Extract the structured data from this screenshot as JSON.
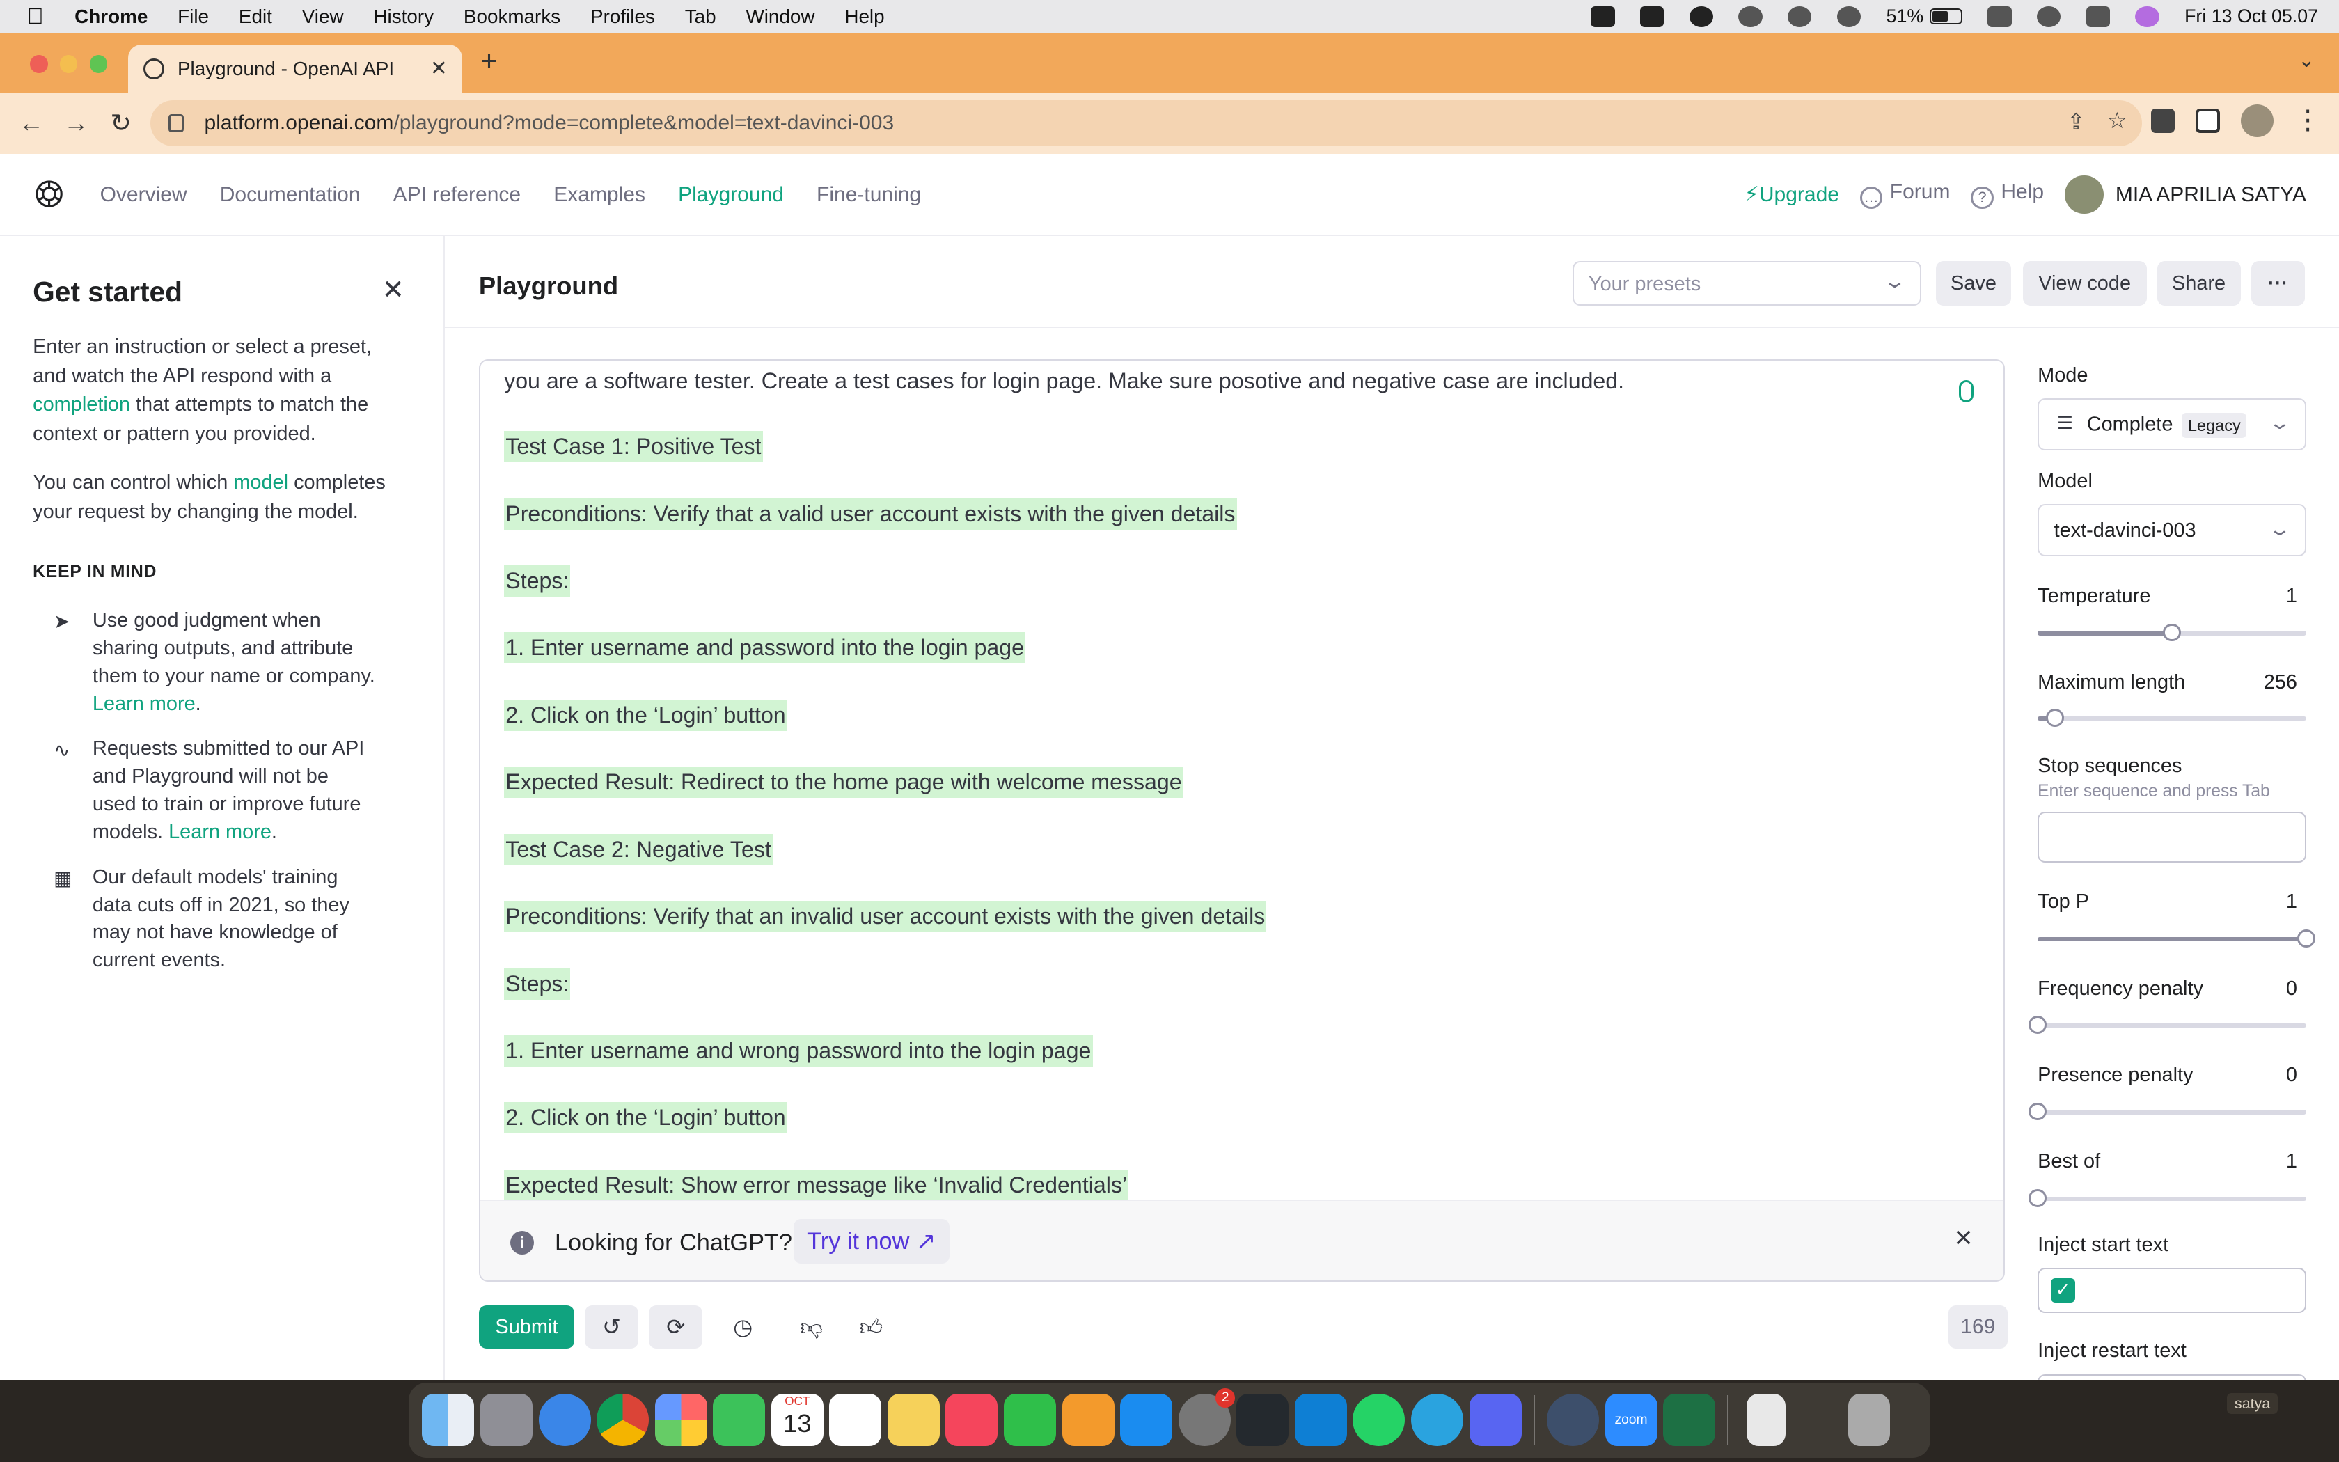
{
  "menubar": {
    "app": "Chrome",
    "items": [
      "File",
      "Edit",
      "View",
      "History",
      "Bookmarks",
      "Profiles",
      "Tab",
      "Window",
      "Help"
    ],
    "battery": "51%",
    "datetime": "Fri 13 Oct  05.07"
  },
  "browser": {
    "tab_title": "Playground - OpenAI API",
    "url_host": "platform.openai.com",
    "url_path": "/playground?mode=complete&model=text-davinci-003"
  },
  "nav": {
    "links": [
      "Overview",
      "Documentation",
      "API reference",
      "Examples",
      "Playground",
      "Fine-tuning"
    ],
    "upgrade": "Upgrade",
    "forum": "Forum",
    "help": "Help",
    "user": "MIA APRILIA SATYA"
  },
  "sidebar": {
    "title": "Get started",
    "intro_a": "Enter an instruction or select a preset, and watch the API respond with a ",
    "intro_link": "completion",
    "intro_b": " that attempts to match the context or pattern you provided.",
    "model_a": "You can control which ",
    "model_link": "model",
    "model_b": " completes your request by changing the model.",
    "keep_in_mind": "KEEP IN MIND",
    "tips": [
      {
        "text": "Use good judgment when sharing outputs, and attribute them to your name or company. ",
        "link": "Learn more",
        "tail": "."
      },
      {
        "text": "Requests submitted to our API and Playground will not be used to train or improve future models. ",
        "link": "Learn more",
        "tail": "."
      },
      {
        "text": "Our default models' training data cuts off in 2021, so they may not have knowledge of current events.",
        "link": "",
        "tail": ""
      }
    ]
  },
  "header": {
    "title": "Playground",
    "presets_placeholder": "Your presets",
    "save": "Save",
    "view_code": "View code",
    "share": "Share",
    "more": "···"
  },
  "editor": {
    "prompt": "you are a software tester. Create a test cases for login page. Make sure posotive and negative case are included.",
    "completion_lines": [
      "Test Case 1: Positive Test",
      "Preconditions: Verify that a valid user account exists with the given details",
      "Steps:",
      "1. Enter username and password into the login page",
      "2. Click on the ‘Login’ button",
      "Expected Result: Redirect to the home page with welcome message",
      "Test Case 2: Negative Test",
      "Preconditions: Verify that an invalid user account exists with the given details",
      "Steps:",
      "1. Enter username and wrong password into the login page",
      "2. Click on the ‘Login’ button",
      "Expected Result: Show error message like ‘Invalid Credentials’"
    ],
    "banner_text": "Looking for ChatGPT?",
    "banner_link": "Try it now"
  },
  "bottom": {
    "submit": "Submit",
    "token_count": "169"
  },
  "settings": {
    "mode_label": "Mode",
    "mode_value": "Complete",
    "mode_badge": "Legacy",
    "model_label": "Model",
    "model_value": "text-davinci-003",
    "temperature": {
      "label": "Temperature",
      "value": "1",
      "min": 0,
      "max": 2,
      "level": 1
    },
    "max_length": {
      "label": "Maximum length",
      "value": "256",
      "min": 1,
      "max": 4000,
      "level": 256
    },
    "stop_label": "Stop sequences",
    "stop_hint": "Enter sequence and press Tab",
    "top_p": {
      "label": "Top P",
      "value": "1",
      "min": 0,
      "max": 1,
      "level": 1
    },
    "frequency_penalty": {
      "label": "Frequency penalty",
      "value": "0",
      "min": 0,
      "max": 2,
      "level": 0
    },
    "presence_penalty": {
      "label": "Presence penalty",
      "value": "0",
      "min": 0,
      "max": 2,
      "level": 0
    },
    "best_of": {
      "label": "Best of",
      "value": "1",
      "min": 1,
      "max": 20,
      "level": 1
    },
    "inject_start": "Inject start text",
    "inject_start_checked": true,
    "inject_restart": "Inject restart text"
  },
  "dock": {
    "calendar_month": "OCT",
    "calendar_day": "13",
    "settings_badge": "2",
    "zoom_label": "zoom",
    "desktop_label": "satya"
  },
  "colors": {
    "accent": "#10a37f",
    "highlight": "#d2f4d3",
    "tab_orange": "#f2a85a",
    "link_purple": "#5436da"
  }
}
